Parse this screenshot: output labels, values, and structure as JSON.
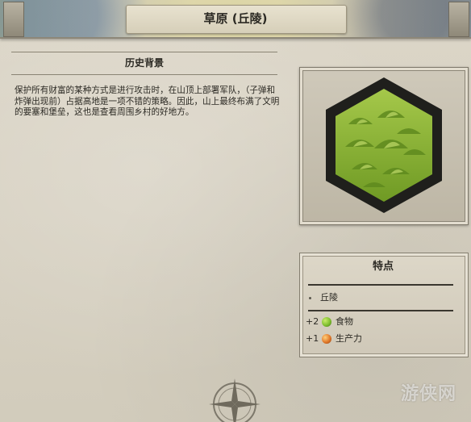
{
  "header": {
    "title": "草原 (丘陵)"
  },
  "history": {
    "heading": "历史背景",
    "text": "保护所有财富的某种方式是进行攻击时，在山顶上部署军队，（子弹和炸弹出现前）占据高地是一项不错的策略。因此，山上最终布满了文明的要塞和堡垒，这也是查看周围乡村的好地方。"
  },
  "features": {
    "heading": "特点",
    "terrain": "丘陵",
    "yields": [
      {
        "amount": "+2",
        "label": "食物",
        "icon": "food-icon",
        "color": "#7fbf2f"
      },
      {
        "amount": "+1",
        "label": "生产力",
        "icon": "production-icon",
        "color": "#e0782a"
      }
    ]
  },
  "watermark": "游侠网",
  "colors": {
    "hills_green": "#8cb43a",
    "hex_border": "#1f1f1c"
  }
}
